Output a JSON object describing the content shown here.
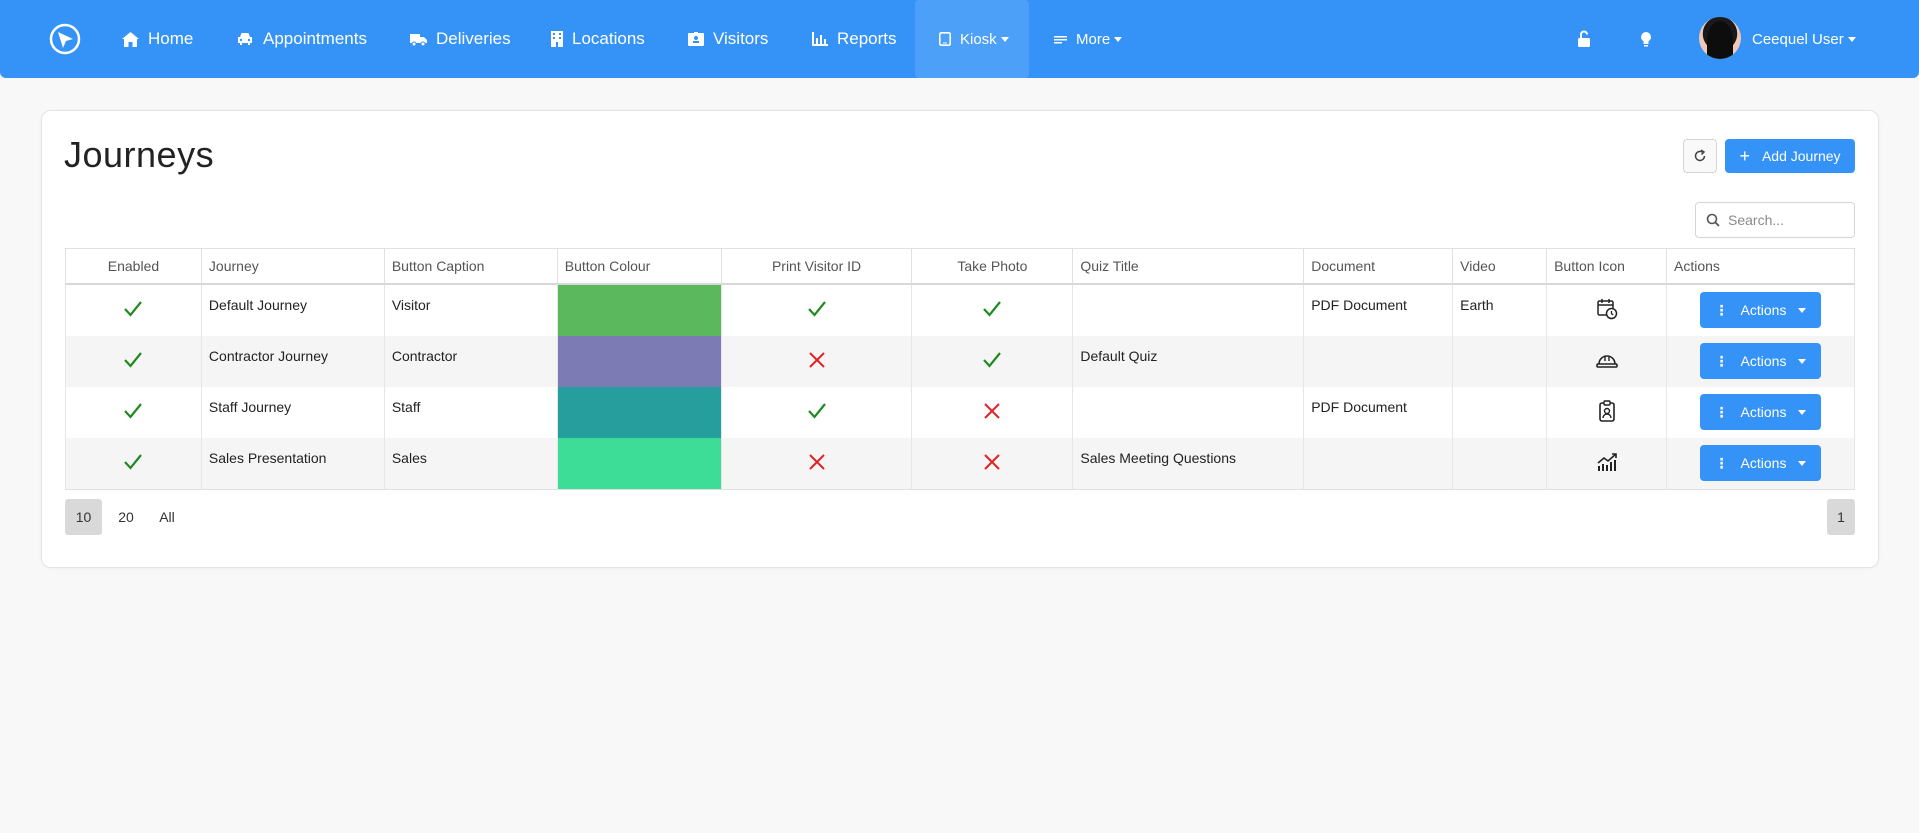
{
  "nav": {
    "items": [
      {
        "label": "Home",
        "icon": "home-icon"
      },
      {
        "label": "Appointments",
        "icon": "car-icon"
      },
      {
        "label": "Deliveries",
        "icon": "truck-icon"
      },
      {
        "label": "Locations",
        "icon": "building-icon"
      },
      {
        "label": "Visitors",
        "icon": "id-badge-icon"
      },
      {
        "label": "Reports",
        "icon": "bar-chart-icon"
      }
    ],
    "kiosk_label": "Kiosk",
    "more_label": "More",
    "user_name": "Ceequel User"
  },
  "page": {
    "title": "Journeys",
    "add_button": "Add Journey",
    "search_placeholder": "Search..."
  },
  "table": {
    "columns": [
      "Enabled",
      "Journey",
      "Button Caption",
      "Button Colour",
      "Print Visitor ID",
      "Take Photo",
      "Quiz Title",
      "Document",
      "Video",
      "Button Icon",
      "Actions"
    ],
    "rows": [
      {
        "enabled": true,
        "journey": "Default Journey",
        "caption": "Visitor",
        "colour": "#5cb85c",
        "print_id": true,
        "take_photo": true,
        "quiz": "",
        "document": "PDF Document",
        "video": "Earth",
        "icon": "calendar-clock-icon",
        "action": "Actions"
      },
      {
        "enabled": true,
        "journey": "Contractor Journey",
        "caption": "Contractor",
        "colour": "#7d7bb4",
        "print_id": false,
        "take_photo": true,
        "quiz": "Default Quiz",
        "document": "",
        "video": "",
        "icon": "hard-hat-icon",
        "action": "Actions"
      },
      {
        "enabled": true,
        "journey": "Staff Journey",
        "caption": "Staff",
        "colour": "#279e9e",
        "print_id": true,
        "take_photo": false,
        "quiz": "",
        "document": "PDF Document",
        "video": "",
        "icon": "id-card-icon",
        "action": "Actions"
      },
      {
        "enabled": true,
        "journey": "Sales Presentation",
        "caption": "Sales",
        "colour": "#3ddc97",
        "print_id": false,
        "take_photo": false,
        "quiz": "Sales Meeting Questions",
        "document": "",
        "video": "",
        "icon": "chart-line-icon",
        "action": "Actions"
      }
    ]
  },
  "pagination": {
    "sizes": [
      "10",
      "20",
      "All"
    ],
    "current_page": "1"
  },
  "colors": {
    "accent": "#3593f7",
    "check": "#1f8a1f",
    "cross": "#e02424"
  }
}
